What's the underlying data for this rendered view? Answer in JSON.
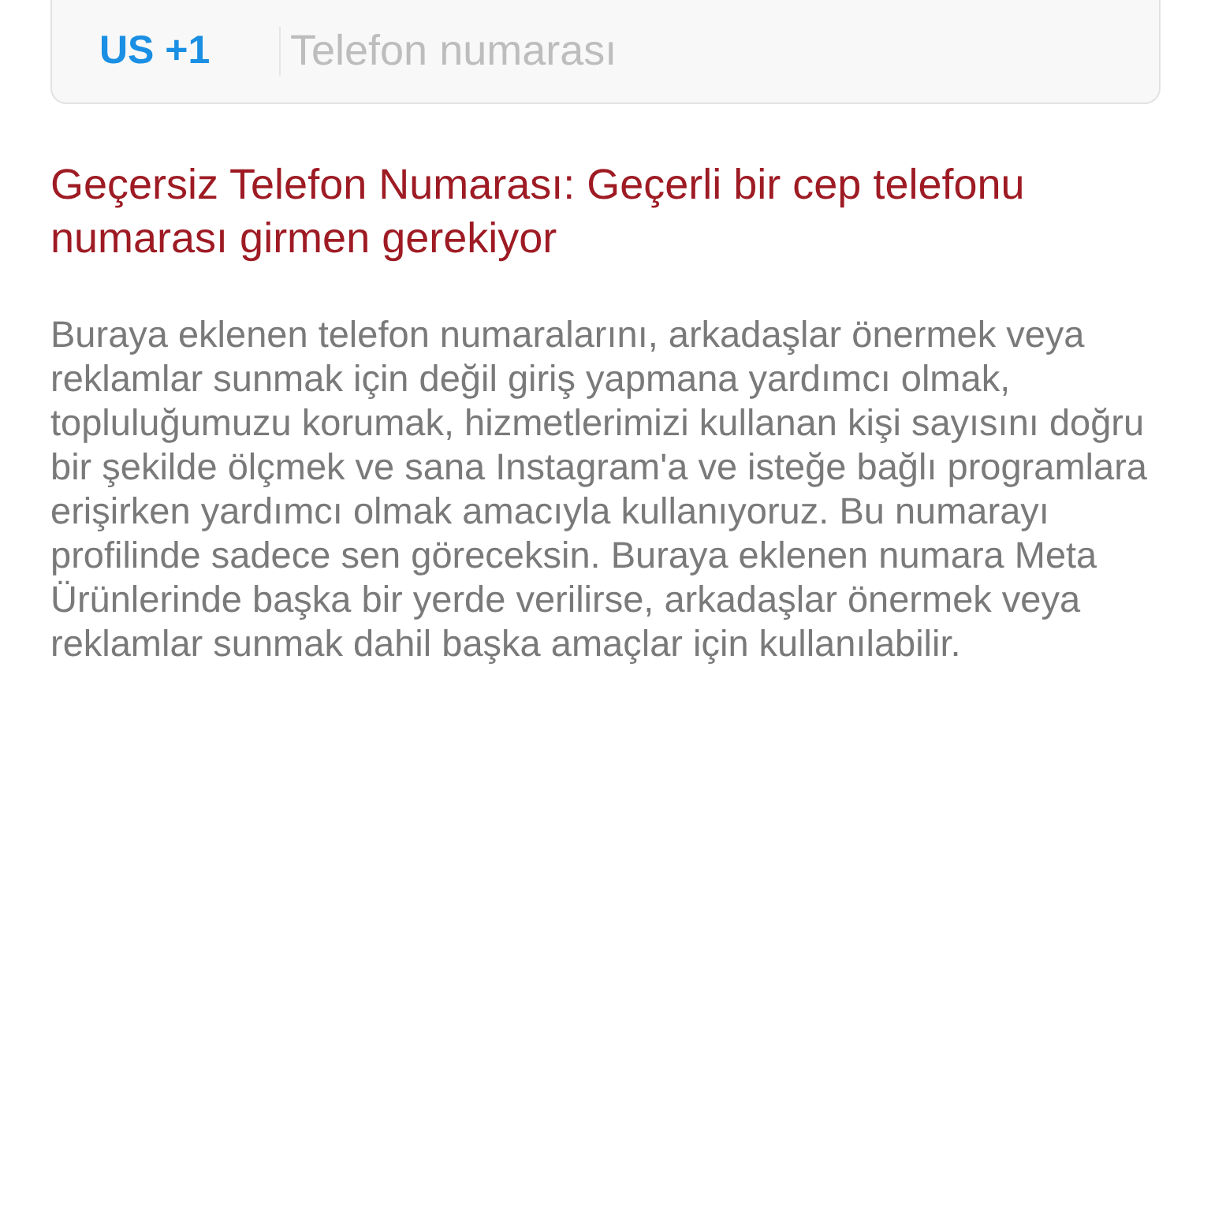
{
  "phone_field": {
    "country_code": "US +1",
    "placeholder": "Telefon numarası"
  },
  "error": "Geçersiz Telefon Numarası: Geçerli bir cep telefonu numarası girmen gerekiyor",
  "info": "Buraya eklenen telefon numaralarını, arkadaşlar önermek veya reklamlar sunmak için değil giriş yapmana yardımcı olmak, topluluğumuzu korumak, hizmetlerimizi kullanan kişi sayısını doğru bir şekilde ölçmek ve sana Instagram'a ve isteğe bağlı programlara erişirken yardımcı olmak amacıyla kullanıyoruz. Bu numarayı profilinde sadece sen göreceksin. Buraya eklenen numara Meta Ürünlerinde başka bir yerde verilirse, arkadaşlar önermek veya reklamlar sunmak dahil başka amaçlar için kullanılabilir."
}
